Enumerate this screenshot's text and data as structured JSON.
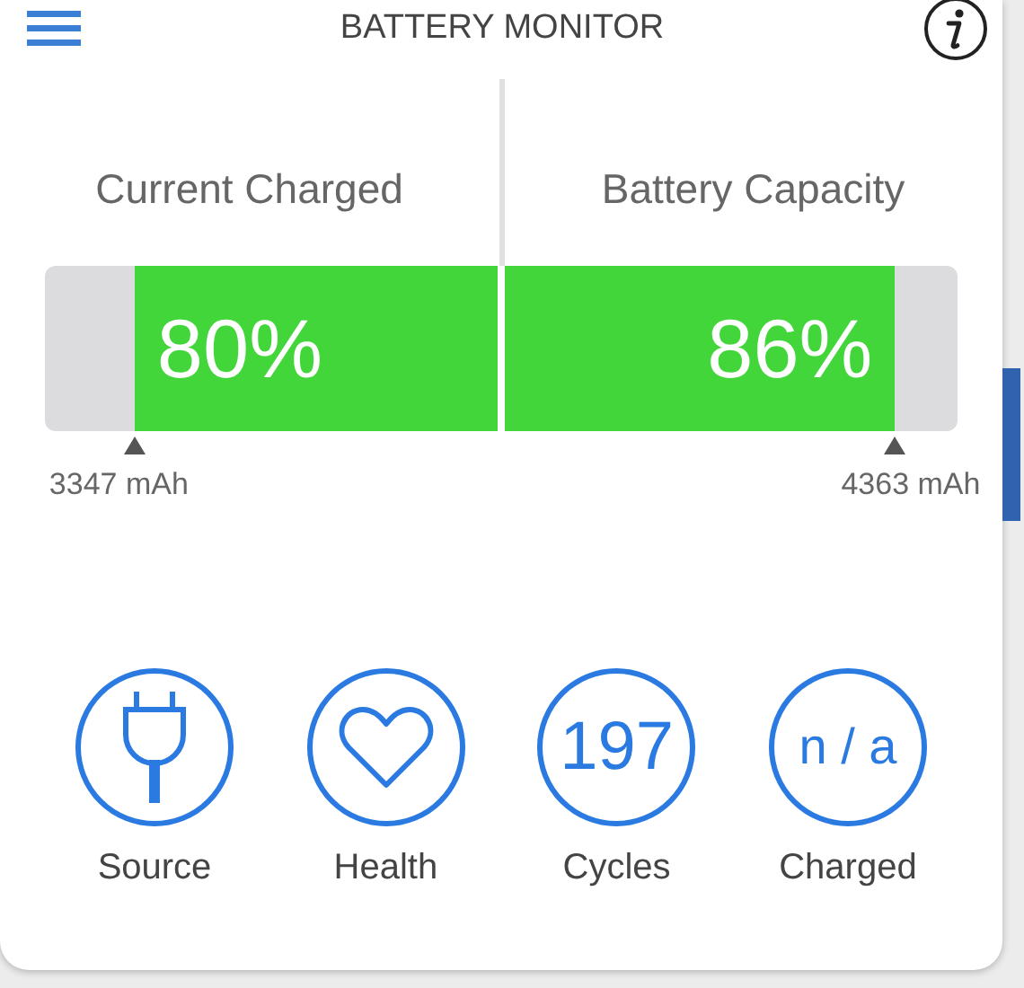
{
  "header": {
    "title": "BATTERY MONITOR"
  },
  "gauges": [
    {
      "kind": "fill-from-right",
      "label": "Current Charged",
      "value": "80%",
      "level": 0.8,
      "reading": "3347 mAh"
    },
    {
      "kind": "fill-from-left",
      "label": "Battery Capacity",
      "value": "86%",
      "level": 0.86,
      "reading": "4363 mAh"
    }
  ],
  "stats": [
    {
      "kind": "plug",
      "label": "Source"
    },
    {
      "kind": "heart",
      "label": "Health"
    },
    {
      "kind": "number",
      "value": "197",
      "label": "Cycles"
    },
    {
      "kind": "text",
      "value": "n / a",
      "label": "Charged"
    }
  ]
}
